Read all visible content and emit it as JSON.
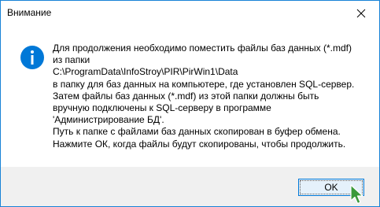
{
  "window": {
    "title": "Внимание"
  },
  "icons": {
    "info": "info-icon",
    "close": "close-icon",
    "cursor": "mouse-pointer-icon"
  },
  "message": {
    "lines": [
      "Для продолжения необходимо поместить файлы баз данных (*.mdf)",
      "из папки",
      "C:\\ProgramData\\InfoStroy\\PIR\\PirWin1\\Data",
      "в папку для баз данных на компьютере, где установлен SQL-сервер.",
      "Затем файлы баз данных (*.mdf) из этой папки должны быть",
      "вручную подключены к SQL-серверу в программе",
      "'Администрирование БД'.",
      "Путь к папке с файлами баз данных скопирован в буфер обмена.",
      "Нажмите ОК, когда файлы будут скопированы, чтобы продолжить."
    ]
  },
  "buttons": {
    "ok_label": "OK"
  },
  "colors": {
    "border": "#1883d7",
    "info_icon": "#0078d7",
    "footer": "#f0f0f0",
    "button_bg": "#e5f1fb",
    "cursor": "#3a9a3a"
  }
}
